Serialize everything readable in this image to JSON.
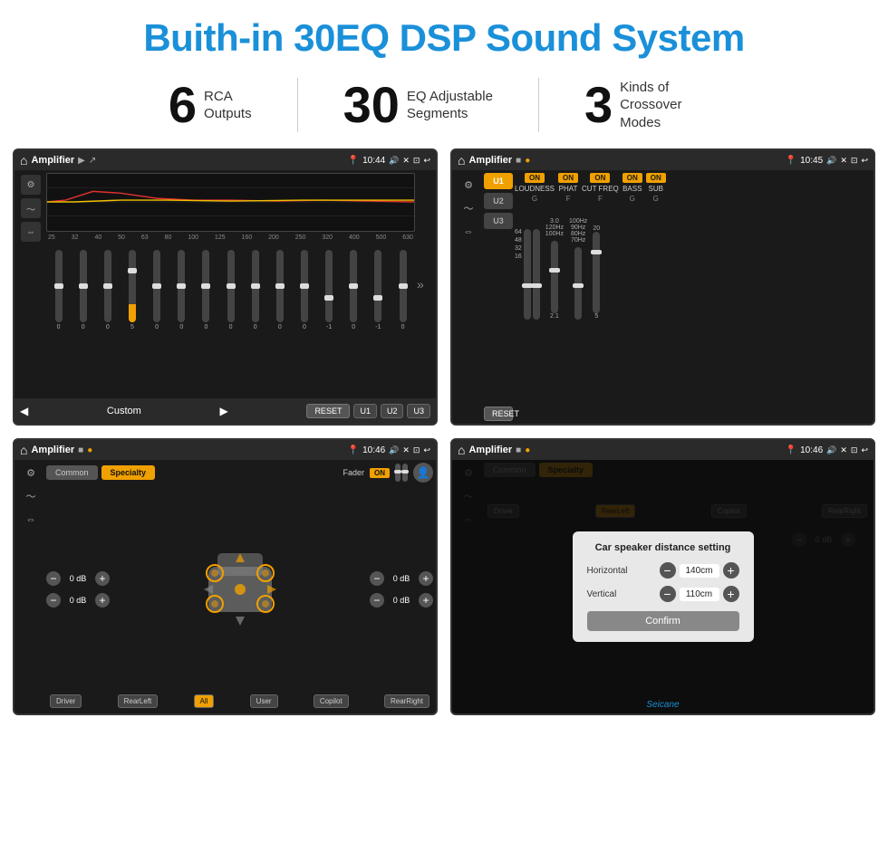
{
  "header": {
    "title": "Buith-in 30EQ DSP Sound System"
  },
  "stats": [
    {
      "number": "6",
      "label": "RCA\nOutputs"
    },
    {
      "number": "30",
      "label": "EQ Adjustable\nSegments"
    },
    {
      "number": "3",
      "label": "Kinds of\nCrossover Modes"
    }
  ],
  "screens": {
    "screen1": {
      "app": "Amplifier",
      "time": "10:44",
      "freqs": [
        "25",
        "32",
        "40",
        "50",
        "63",
        "80",
        "100",
        "125",
        "160",
        "200",
        "250",
        "320",
        "400",
        "500",
        "630"
      ],
      "values": [
        "0",
        "0",
        "0",
        "5",
        "0",
        "0",
        "0",
        "0",
        "0",
        "0",
        "0",
        "-1",
        "0",
        "-1"
      ],
      "preset": "Custom",
      "buttons": [
        "RESET",
        "U1",
        "U2",
        "U3"
      ]
    },
    "screen2": {
      "app": "Amplifier",
      "time": "10:45",
      "channels": [
        "U1",
        "U2",
        "U3",
        "RESET"
      ],
      "controls": [
        "LOUDNESS",
        "PHAT",
        "CUT FREQ",
        "BASS",
        "SUB"
      ],
      "on_labels": [
        "ON",
        "ON",
        "ON",
        "ON",
        "ON"
      ]
    },
    "screen3": {
      "app": "Amplifier",
      "time": "10:46",
      "tabs": [
        "Common",
        "Specialty"
      ],
      "fader": "Fader",
      "fader_state": "ON",
      "db_values": [
        "0 dB",
        "0 dB",
        "0 dB",
        "0 dB"
      ],
      "speaker_buttons": [
        "Driver",
        "RearLeft",
        "All",
        "User",
        "Copilot",
        "RearRight"
      ]
    },
    "screen4": {
      "app": "Amplifier",
      "time": "10:46",
      "dialog": {
        "title": "Car speaker distance setting",
        "horizontal_label": "Horizontal",
        "horizontal_value": "140cm",
        "vertical_label": "Vertical",
        "vertical_value": "110cm",
        "confirm_label": "Confirm"
      },
      "db_values": [
        "0 dB"
      ],
      "speaker_buttons": [
        "Driver",
        "RearLeft",
        "Copilot",
        "RearRight"
      ]
    }
  },
  "branding": "Seicane"
}
